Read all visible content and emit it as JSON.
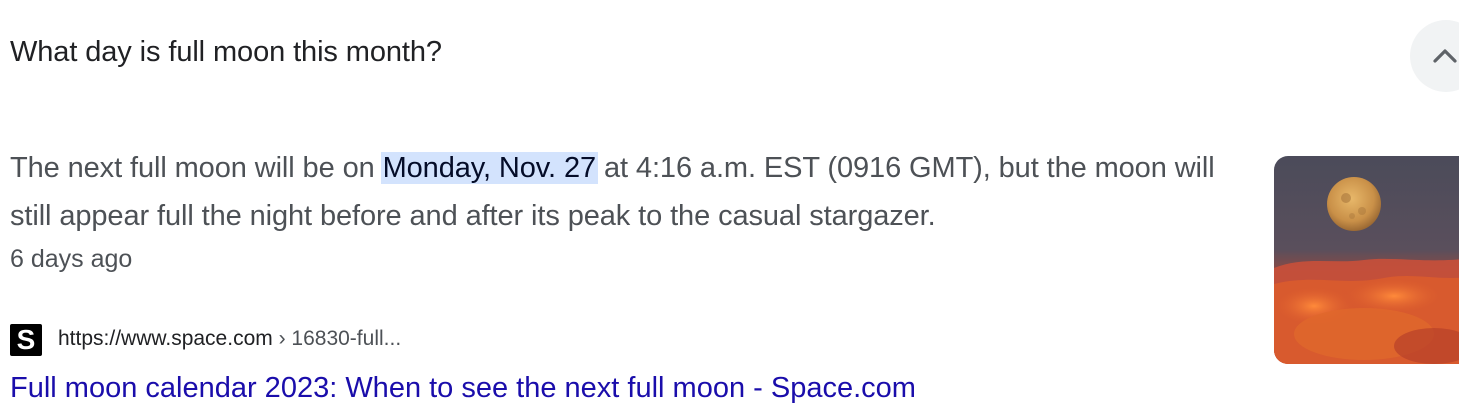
{
  "question": "What day is full moon this month?",
  "collapse_button": {
    "icon": "chevron-up-icon"
  },
  "answer": {
    "before": "The next full moon will be on ",
    "highlight": "Monday, Nov. 27",
    "after": " at 4:16 a.m. EST (0916 GMT), but the moon will still appear full the night before and after its peak to the casual stargazer."
  },
  "date": "6 days ago",
  "source": {
    "favicon_letter": "S",
    "url": "https://www.space.com",
    "path": " › 16830-full...",
    "title": "Full moon calendar 2023: When to see the next full moon - Space.com"
  },
  "colors": {
    "highlight_bg": "#d3e3fd",
    "link": "#1a0dab",
    "body_text": "#4d5156"
  }
}
